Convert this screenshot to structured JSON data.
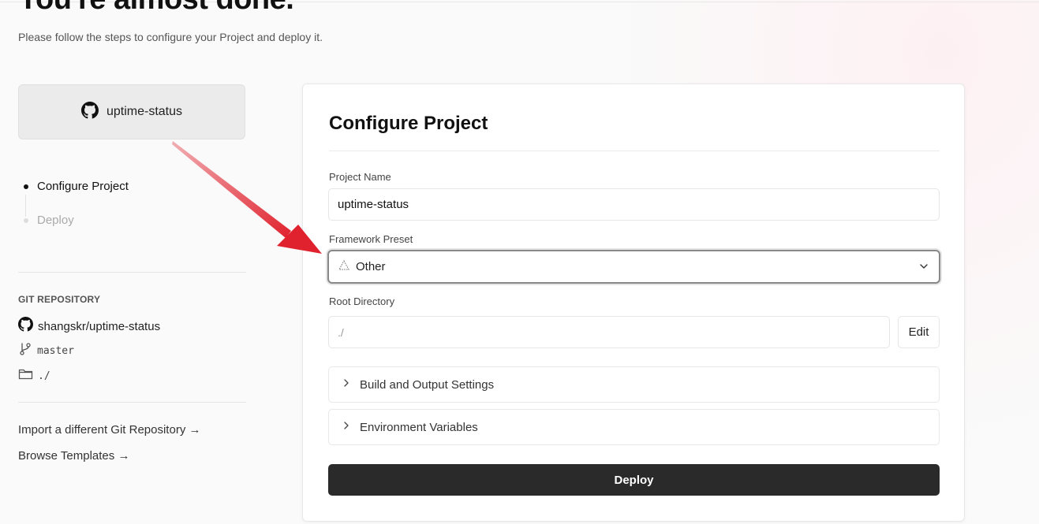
{
  "header": {
    "title": "You're almost done.",
    "subtitle": "Please follow the steps to configure your Project and deploy it."
  },
  "sidebar": {
    "repo_card": {
      "icon": "github-icon",
      "name": "uptime-status"
    },
    "steps": [
      {
        "label": "Configure Project",
        "active": true
      },
      {
        "label": "Deploy",
        "active": false
      }
    ],
    "git": {
      "section_title": "GIT REPOSITORY",
      "repository": "shangskr/uptime-status",
      "branch": "master",
      "directory": "./"
    },
    "links": [
      {
        "label": "Import a different Git Repository →"
      },
      {
        "label": "Browse Templates →"
      }
    ]
  },
  "form": {
    "title": "Configure Project",
    "project_name": {
      "label": "Project Name",
      "value": "uptime-status"
    },
    "framework_preset": {
      "label": "Framework Preset",
      "value": "Other",
      "icon": "triangle-icon"
    },
    "root_directory": {
      "label": "Root Directory",
      "value": "./",
      "edit_label": "Edit"
    },
    "sections": [
      {
        "label": "Build and Output Settings"
      },
      {
        "label": "Environment Variables"
      }
    ],
    "deploy_label": "Deploy"
  },
  "colors": {
    "annotation_arrow": "#e0222e",
    "deploy_button": "#2a2a2a",
    "background": "#fafafa"
  }
}
